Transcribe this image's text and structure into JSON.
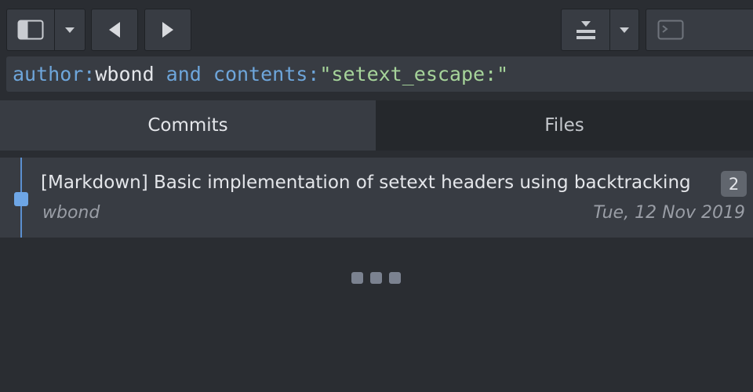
{
  "toolbar": {
    "sidebar_toggle": {
      "icon": "sidebar-icon"
    },
    "sidebar_dropdown": {
      "icon": "caret-down-icon"
    },
    "back": {
      "icon": "arrow-left-icon"
    },
    "forward": {
      "icon": "arrow-right-icon"
    },
    "merge": {
      "icon": "merge-icon"
    },
    "merge_dropdown": {
      "icon": "caret-down-icon"
    },
    "terminal": {
      "icon": "terminal-icon"
    }
  },
  "search": {
    "tokens": [
      {
        "kind": "key",
        "text": "author:"
      },
      {
        "kind": "val",
        "text": "wbond"
      },
      {
        "kind": "op",
        "text": " and "
      },
      {
        "kind": "key",
        "text": "contents:"
      },
      {
        "kind": "str",
        "text": "\"setext_escape:\""
      }
    ]
  },
  "tabs": [
    {
      "label": "Commits",
      "active": true
    },
    {
      "label": "Files",
      "active": false
    }
  ],
  "commits": [
    {
      "summary": "[Markdown] Basic implementation of setext headers using backtracking",
      "file_count": "2",
      "author": "wbond",
      "date": "Tue, 12 Nov 2019"
    }
  ],
  "colors": {
    "background": "#2a2d32",
    "panel": "#383c43",
    "accent": "#6ea6e6",
    "query_key": "#6ea6db",
    "query_string": "#a6d49a"
  }
}
